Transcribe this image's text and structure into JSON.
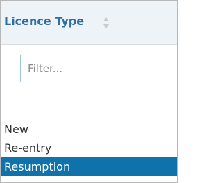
{
  "column_header": {
    "title": "Licence Type",
    "sort_icon": "sort-up-down-icon",
    "accent_color": "#2f6ea5"
  },
  "filter": {
    "placeholder": "Filter...",
    "value": ""
  },
  "options": [
    {
      "label": "New",
      "selected": false
    },
    {
      "label": "Re-entry",
      "selected": false
    },
    {
      "label": "Resumption",
      "selected": true
    }
  ],
  "colors": {
    "selected_bg": "#0f72aa",
    "selected_text": "#ffffff",
    "header_bg": "#eef3f7"
  }
}
